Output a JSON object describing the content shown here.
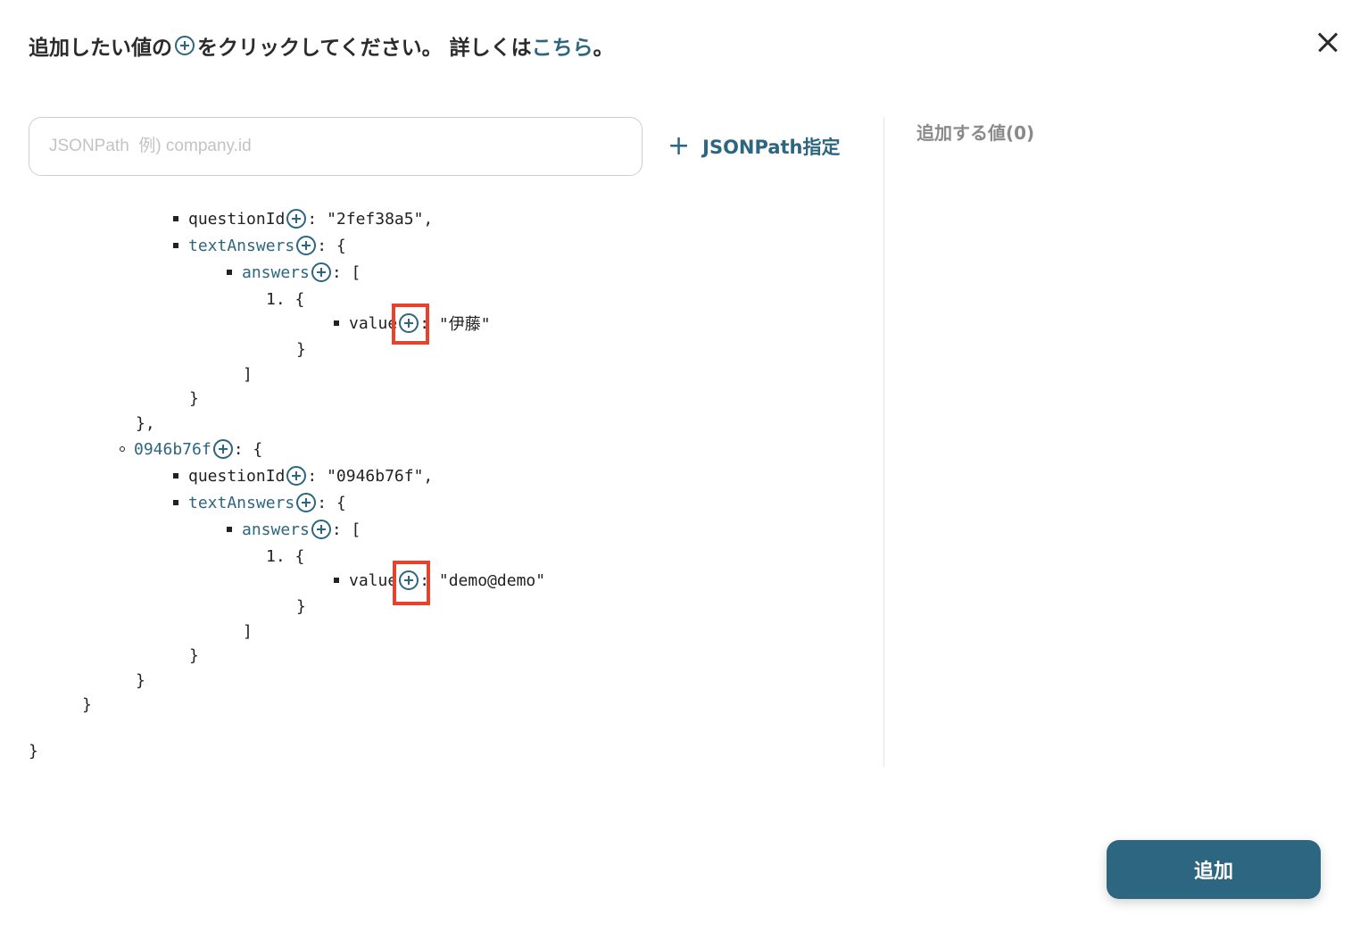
{
  "header": {
    "instruction_pre": "追加したい値の",
    "instruction_post": "をクリックしてください。 詳しくは",
    "link": "こちら",
    "tail": "。"
  },
  "search": {
    "placeholder": "JSONPath  例) company.id"
  },
  "jsonpath_button": {
    "label": "JSONPath指定"
  },
  "right_panel": {
    "title": "追加する値(0)"
  },
  "tree": {
    "q1": {
      "questionId_key": "questionId",
      "questionId_value": "\"2fef38a5\",",
      "textAnswers_key": "textAnswers",
      "answers_key": "answers",
      "index": "1.",
      "value_key": "value",
      "value": "\"伊藤\""
    },
    "section2_key": "0946b76f",
    "q2": {
      "questionId_key": "questionId",
      "questionId_value": "\"0946b76f\",",
      "textAnswers_key": "textAnswers",
      "answers_key": "answers",
      "index": "1.",
      "value_key": "value",
      "value": "\"demo@demo\""
    }
  },
  "add_button": {
    "label": "追加"
  }
}
